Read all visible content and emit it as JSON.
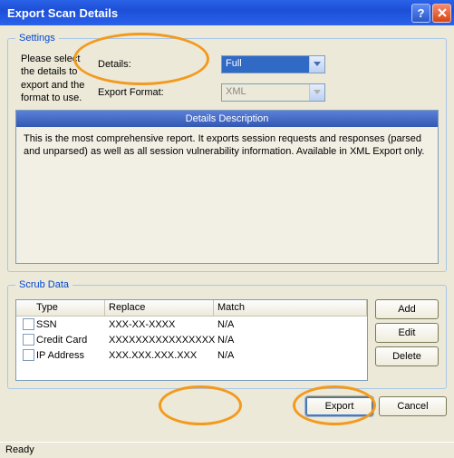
{
  "titlebar": {
    "title": "Export Scan Details"
  },
  "settings": {
    "legend": "Settings",
    "details_label": "Details:",
    "details_value": "Full",
    "format_label": "Export Format:",
    "format_value": "XML",
    "help_text": "Please select the details to export and the format to use."
  },
  "description": {
    "header": "Details Description",
    "body": "This is the most comprehensive report. It exports session requests and responses (parsed and unparsed) as well as all session vulnerability information. Available in XML Export only."
  },
  "scrub": {
    "legend": "Scrub Data",
    "headers": {
      "type": "Type",
      "replace": "Replace",
      "match": "Match"
    },
    "rows": [
      {
        "type": "SSN",
        "replace": "XXX-XX-XXXX",
        "match": "N/A"
      },
      {
        "type": "Credit Card",
        "replace": "XXXXXXXXXXXXXXXX",
        "match": "N/A"
      },
      {
        "type": "IP Address",
        "replace": "XXX.XXX.XXX.XXX",
        "match": "N/A"
      }
    ],
    "buttons": {
      "add": "Add",
      "edit": "Edit",
      "delete": "Delete"
    }
  },
  "actions": {
    "export": "Export",
    "cancel": "Cancel"
  },
  "status": "Ready",
  "highlight": {
    "color": "#f39a1e"
  }
}
